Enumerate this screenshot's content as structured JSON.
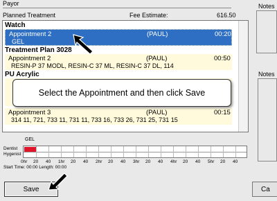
{
  "header": {
    "payor_label": "Payor",
    "planned_label": "Planned Treatment",
    "fee_label": "Fee Estimate:",
    "fee_value": "616.50",
    "notes_label": "Notes",
    "notes_label_2": "Notes"
  },
  "list": {
    "groups": [
      {
        "title": "Watch"
      },
      {
        "title": "Treatment Plan 3028"
      },
      {
        "title": "PU Acrylic"
      }
    ],
    "appointments": [
      {
        "name": "Appointment 2",
        "provider": "(PAUL)",
        "duration": "00:20",
        "detail": "GEL",
        "selected": true
      },
      {
        "name": "Appointment 2",
        "provider": "(PAUL)",
        "duration": "00:50",
        "detail": "RESIN-P  37  MODL, RESIN-C  37  ML, RESIN-C  37  DL, 114"
      },
      {
        "name": "Appointment 3",
        "provider": "(PAUL)",
        "duration": "00:15",
        "detail": "314  11, 721, 733  11, 731  11, 733  16, 733  26, 731  25, 731  15"
      }
    ]
  },
  "callout": {
    "text": "Select the Appointment and then click Save"
  },
  "timeline": {
    "block_label": "GEL",
    "row_labels": [
      "Dentist",
      "Hygenist"
    ],
    "ticks": [
      "0hr",
      "20",
      "40",
      "1hr",
      "20",
      "40",
      "2hr",
      "20",
      "40",
      "3hr",
      "20",
      "40",
      "4hr",
      "20",
      "40",
      "5hr",
      "20",
      "40"
    ],
    "start_text": "Start Time:  00:00   Length:      00:00",
    "block_minutes": 20
  },
  "buttons": {
    "save": "Save",
    "cancel": "Ca"
  },
  "colors": {
    "selection": "#2f6fc3",
    "appointment_bg": "#fffadc",
    "timeline_block": "#e0152a"
  }
}
